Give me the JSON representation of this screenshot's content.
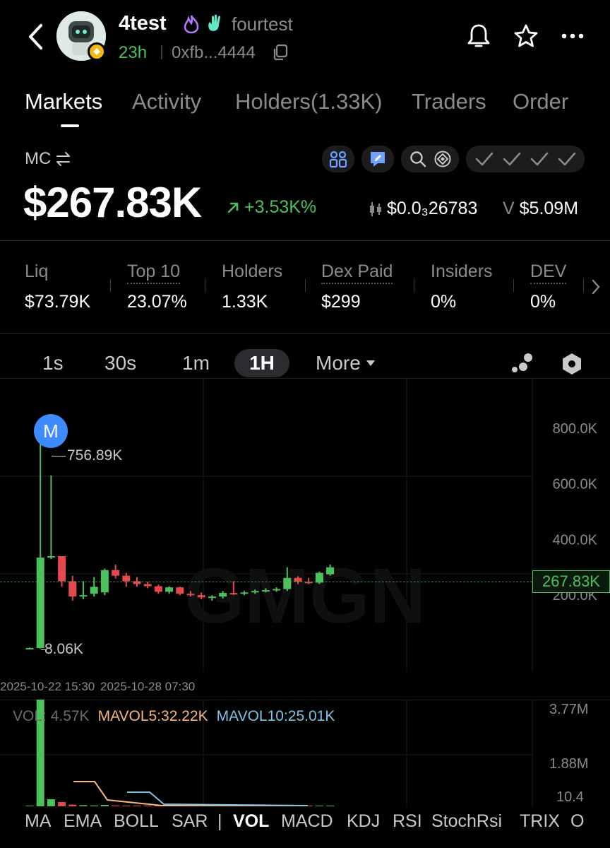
{
  "header": {
    "token_name": "4test",
    "creator_handle": "fourtest",
    "age": "23h",
    "address": "0xfb...4444"
  },
  "tabs": [
    "Markets",
    "Activity",
    "Holders(1.33K)",
    "Traders",
    "Order"
  ],
  "market": {
    "mc_label": "MC",
    "market_cap": "$267.83K",
    "change": "+3.53K%",
    "price": "$0.0₃26783",
    "volume_prefix": "V",
    "volume": "$5.09M"
  },
  "stats": [
    {
      "label": "Liq",
      "value": "$73.79K"
    },
    {
      "label": "Top 10",
      "value": "23.07%"
    },
    {
      "label": "Holders",
      "value": "1.33K"
    },
    {
      "label": "Dex Paid",
      "value": "$299"
    },
    {
      "label": "Insiders",
      "value": "0%"
    },
    {
      "label": "DEV",
      "value": "0%"
    }
  ],
  "timeframes": {
    "items": [
      "1s",
      "30s",
      "1m",
      "1H"
    ],
    "active": "1H",
    "more": "More"
  },
  "chart": {
    "marker_label": "M",
    "high_label": "756.89K",
    "low_label": "8.06K",
    "current_label": "267.83K",
    "watermark": "GMGN",
    "y_ticks": [
      "800.0K",
      "600.0K",
      "400.0K",
      "200.0K"
    ],
    "x_ticks": [
      "2025-10-22 15:30",
      "2025-10-28 07:30"
    ]
  },
  "volume": {
    "vol_label": "VOL: 4.57K",
    "mavol5": "MAVOL5:32.22K",
    "mavol10": "MAVOL10:25.01K",
    "y_ticks": [
      "3.77M",
      "1.88M",
      "10.4"
    ]
  },
  "indicators": [
    "MA",
    "EMA",
    "BOLL",
    "SAR",
    "|",
    "VOL",
    "MACD",
    "KDJ",
    "RSI",
    "StochRsi",
    "TRIX",
    "O"
  ],
  "active_indicator": "VOL",
  "colors": {
    "up": "#4cc05b",
    "down": "#e5484d",
    "mavol5": "#f5b87a",
    "mavol10": "#7ec3e6",
    "accent": "#3d8bff"
  },
  "chart_data": {
    "type": "candlestick",
    "y_unit": "market cap",
    "ylim": [
      0,
      900000
    ],
    "candles": [
      {
        "o": 10000,
        "h": 12000,
        "l": 8060,
        "c": 10000
      },
      {
        "o": 10000,
        "h": 756890,
        "l": 8060,
        "c": 335000
      },
      {
        "o": 335000,
        "h": 630000,
        "l": 330000,
        "c": 340000
      },
      {
        "o": 340000,
        "h": 340000,
        "l": 230000,
        "c": 250000
      },
      {
        "o": 250000,
        "h": 270000,
        "l": 180000,
        "c": 195000
      },
      {
        "o": 200000,
        "h": 250000,
        "l": 185000,
        "c": 200000
      },
      {
        "o": 205000,
        "h": 265000,
        "l": 195000,
        "c": 230000
      },
      {
        "o": 210000,
        "h": 295000,
        "l": 200000,
        "c": 290000
      },
      {
        "o": 290000,
        "h": 310000,
        "l": 260000,
        "c": 270000
      },
      {
        "o": 270000,
        "h": 280000,
        "l": 230000,
        "c": 250000
      },
      {
        "o": 250000,
        "h": 265000,
        "l": 230000,
        "c": 240000
      },
      {
        "o": 240000,
        "h": 248000,
        "l": 225000,
        "c": 232000
      },
      {
        "o": 232000,
        "h": 238000,
        "l": 205000,
        "c": 212000
      },
      {
        "o": 212000,
        "h": 232000,
        "l": 205000,
        "c": 228000
      },
      {
        "o": 228000,
        "h": 230000,
        "l": 200000,
        "c": 205000
      },
      {
        "o": 205000,
        "h": 215000,
        "l": 195000,
        "c": 200000
      },
      {
        "o": 200000,
        "h": 210000,
        "l": 185000,
        "c": 192000
      },
      {
        "o": 192000,
        "h": 200000,
        "l": 180000,
        "c": 195000
      },
      {
        "o": 195000,
        "h": 215000,
        "l": 188000,
        "c": 208000
      },
      {
        "o": 208000,
        "h": 250000,
        "l": 200000,
        "c": 205000
      },
      {
        "o": 205000,
        "h": 215000,
        "l": 200000,
        "c": 210000
      },
      {
        "o": 210000,
        "h": 220000,
        "l": 205000,
        "c": 215000
      },
      {
        "o": 215000,
        "h": 225000,
        "l": 210000,
        "c": 218000
      },
      {
        "o": 218000,
        "h": 228000,
        "l": 212000,
        "c": 222000
      },
      {
        "o": 222000,
        "h": 300000,
        "l": 215000,
        "c": 262000
      },
      {
        "o": 262000,
        "h": 268000,
        "l": 240000,
        "c": 248000
      },
      {
        "o": 248000,
        "h": 262000,
        "l": 240000,
        "c": 245000
      },
      {
        "o": 245000,
        "h": 285000,
        "l": 240000,
        "c": 280000
      },
      {
        "o": 275000,
        "h": 310000,
        "l": 270000,
        "c": 300000
      }
    ],
    "volume_bars": [
      0.01,
      3770000,
      250000,
      150000,
      60000,
      40000,
      30000,
      50000,
      30000,
      20000,
      20000,
      15000,
      15000,
      15000,
      10000,
      10000,
      10000,
      10000,
      10000,
      10000,
      10000,
      10000,
      10000,
      10000,
      20000,
      10000,
      10000,
      15000,
      15000
    ],
    "volume_ylim": [
      0,
      3770000
    ]
  }
}
